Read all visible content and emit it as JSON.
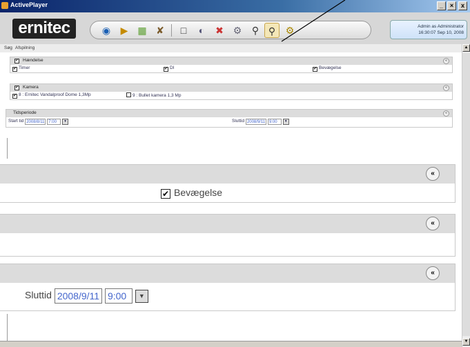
{
  "window": {
    "title": "ActivePlayer",
    "minimize": "_",
    "maximize": "×",
    "close": "x"
  },
  "header": {
    "logo": "ernitec",
    "user": "Admin as Administrator",
    "datetime": "16:30:07 Sep 10, 2008",
    "toolbar_icons": [
      "eye-icon",
      "camera-play-icon",
      "map-icon",
      "tools-icon",
      "fullscreen-icon",
      "camera-switch-icon",
      "camera-delete-icon",
      "camera-settings-icon",
      "search-icon",
      "search-active-icon",
      "search-settings-icon"
    ]
  },
  "menu": {
    "search": "Søg",
    "playback": "Afspilning"
  },
  "panels": {
    "event": {
      "title": "Hændelse",
      "items": [
        "Timer",
        "DI",
        "Bevægelse"
      ]
    },
    "camera": {
      "title": "Kamera",
      "items": [
        "8 : Ernitec Vandalproof Dome 1,3Mp",
        "9 : Bullet kamera 1,3 Mp"
      ]
    },
    "period": {
      "title": "Tidsperiode",
      "start_label": "Start tid",
      "start_date": "2008/8/11",
      "start_time": "7:00",
      "end_label": "Sluttid",
      "end_date": "2008/9/11",
      "end_time": "9:00"
    }
  },
  "zoom": {
    "motion_label": "Bevægelse",
    "end_label": "Sluttid",
    "end_date": "2008/9/11",
    "end_time": "9:00"
  },
  "glyphs": {
    "check": "✔",
    "collapse": "«",
    "down": "▼",
    "up": "▲"
  }
}
